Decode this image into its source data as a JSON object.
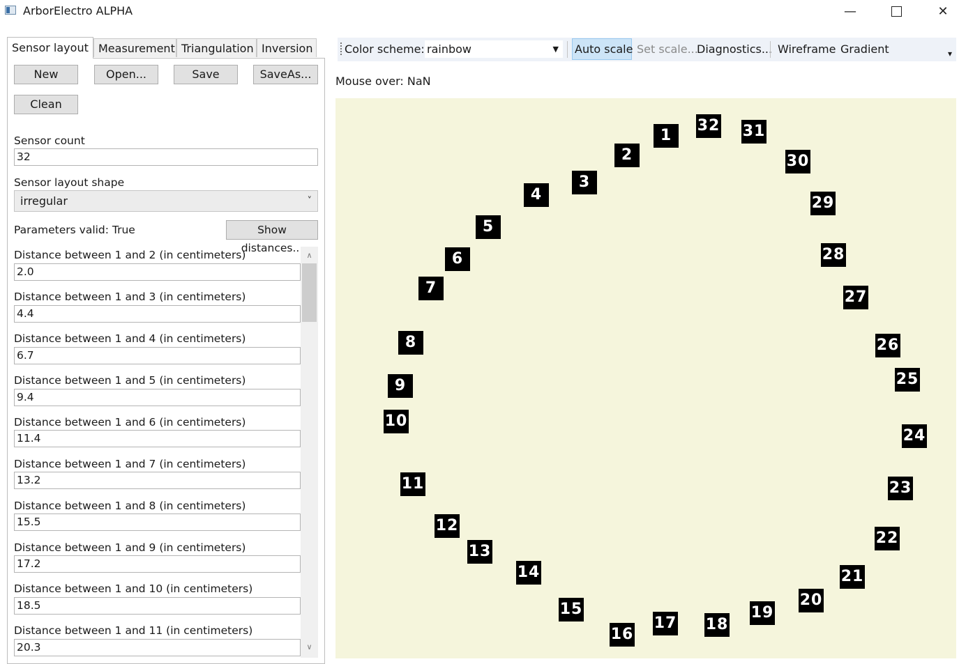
{
  "window": {
    "title": "ArborElectro ALPHA",
    "minimize_glyph": "—",
    "close_glyph": "✕"
  },
  "tabs": [
    {
      "label": "Sensor layout",
      "active": true
    },
    {
      "label": "Measurement",
      "active": false
    },
    {
      "label": "Triangulation",
      "active": false
    },
    {
      "label": "Inversion",
      "active": false
    }
  ],
  "buttons": {
    "new": "New",
    "open": "Open...",
    "save": "Save",
    "saveas": "SaveAs...",
    "clean": "Clean",
    "show_distances": "Show distances..."
  },
  "sensor_count": {
    "label": "Sensor count",
    "value": "32"
  },
  "layout_shape": {
    "label": "Sensor layout shape",
    "value": "irregular",
    "chevron": "˅"
  },
  "params_valid": "Parameters valid: True",
  "distances": [
    {
      "label": "Distance between 1 and 2 (in centimeters)",
      "value": "2.0"
    },
    {
      "label": "Distance between 1 and 3 (in centimeters)",
      "value": "4.4"
    },
    {
      "label": "Distance between 1 and 4 (in centimeters)",
      "value": "6.7"
    },
    {
      "label": "Distance between 1 and 5 (in centimeters)",
      "value": "9.4"
    },
    {
      "label": "Distance between 1 and 6 (in centimeters)",
      "value": "11.4"
    },
    {
      "label": "Distance between 1 and 7 (in centimeters)",
      "value": "13.2"
    },
    {
      "label": "Distance between 1 and 8 (in centimeters)",
      "value": "15.5"
    },
    {
      "label": "Distance between 1 and 9 (in centimeters)",
      "value": "17.2"
    },
    {
      "label": "Distance between 1 and 10 (in centimeters)",
      "value": "18.5"
    },
    {
      "label": "Distance between 1 and 11 (in centimeters)",
      "value": "20.3"
    }
  ],
  "scrollbar": {
    "up": "∧",
    "down": "∨"
  },
  "toolbar": {
    "color_scheme_label": "Color scheme:",
    "color_scheme_value": "rainbow",
    "combo_arrow": "▼",
    "auto_scale": "Auto scale",
    "set_scale": "Set scale...",
    "diagnostics": "Diagnostics...",
    "wireframe": "Wireframe",
    "gradient": "Gradient",
    "overflow": "▾"
  },
  "mouse_over": "Mouse over: NaN",
  "canvas_bg": "#f5f5dc",
  "sensors": [
    "1",
    "2",
    "3",
    "4",
    "5",
    "6",
    "7",
    "8",
    "9",
    "10",
    "11",
    "12",
    "13",
    "14",
    "15",
    "16",
    "17",
    "18",
    "19",
    "20",
    "21",
    "22",
    "23",
    "24",
    "25",
    "26",
    "27",
    "28",
    "29",
    "30",
    "31",
    "32"
  ]
}
